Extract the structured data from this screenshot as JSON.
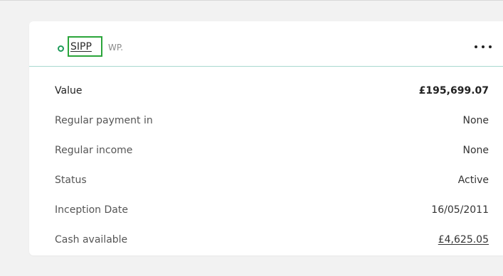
{
  "account": {
    "name": "SIPP",
    "code": "WP.",
    "status_color": "#1e9b5a"
  },
  "details": [
    {
      "label": "Value",
      "value": "£195,699.07"
    },
    {
      "label": "Regular payment in",
      "value": "None"
    },
    {
      "label": "Regular income",
      "value": "None"
    },
    {
      "label": "Status",
      "value": "Active"
    },
    {
      "label": "Inception Date",
      "value": "16/05/2011"
    },
    {
      "label": "Cash available",
      "value": "£4,625.05"
    }
  ],
  "icons": {
    "status": "status-ring-icon",
    "menu": "more-options-icon"
  },
  "colors": {
    "accent_green": "#2aa53a",
    "divider": "#a8d8cf"
  }
}
